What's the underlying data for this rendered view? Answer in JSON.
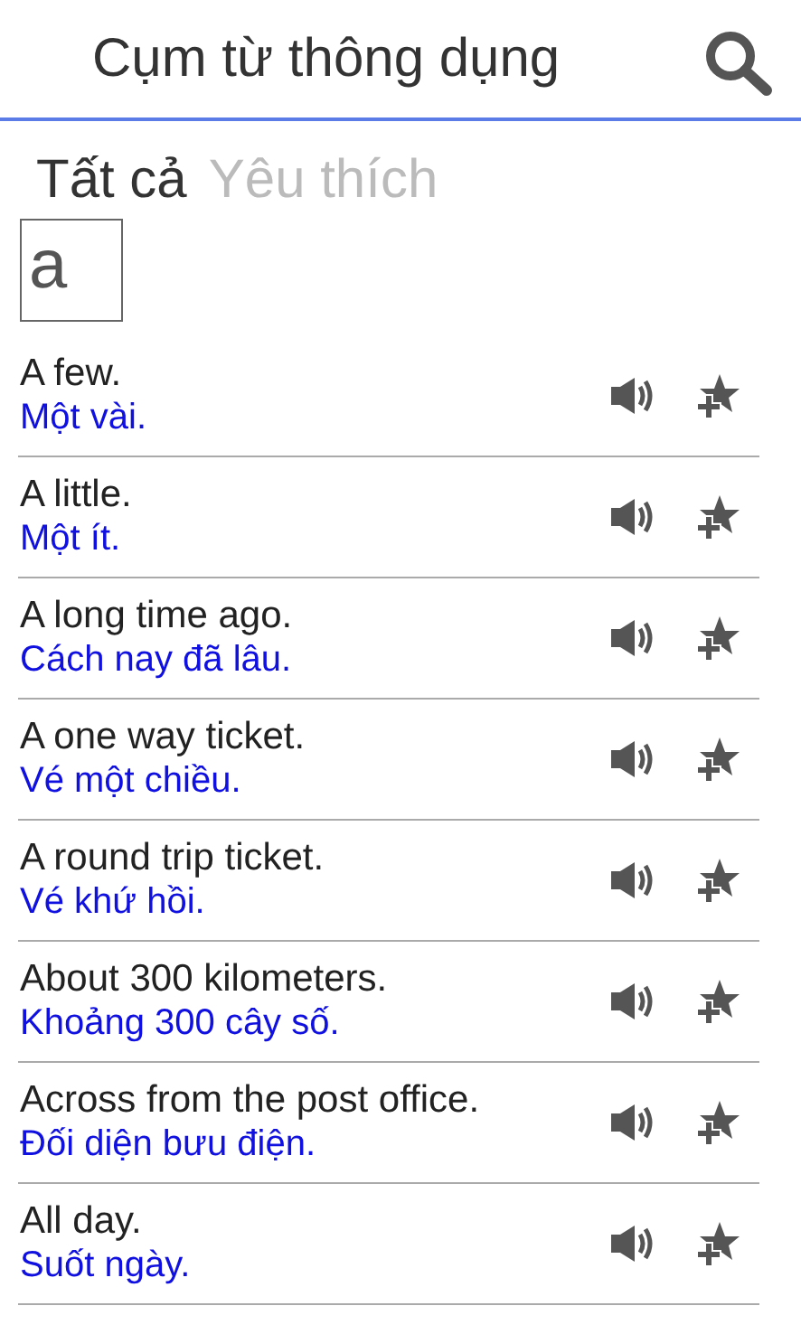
{
  "header": {
    "title": "Cụm từ thông dụng"
  },
  "tabs": [
    {
      "label": "Tất cả",
      "selected": true
    },
    {
      "label": "Yêu thích",
      "selected": false
    }
  ],
  "letter": "a",
  "phrases": [
    {
      "english": "A few.",
      "vietnamese": "Một vài."
    },
    {
      "english": "A little.",
      "vietnamese": "Một ít."
    },
    {
      "english": "A long time ago.",
      "vietnamese": "Cách nay đã lâu."
    },
    {
      "english": "A one way ticket.",
      "vietnamese": "Vé một chiều."
    },
    {
      "english": "A round trip ticket.",
      "vietnamese": "Vé khứ hồi."
    },
    {
      "english": "About 300 kilometers.",
      "vietnamese": "Khoảng 300 cây số."
    },
    {
      "english": "Across from the post office.",
      "vietnamese": "Đối diện bưu điện."
    },
    {
      "english": "All day.",
      "vietnamese": "Suốt ngày."
    }
  ]
}
